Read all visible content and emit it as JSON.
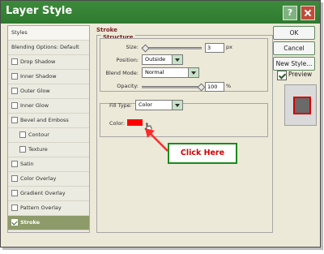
{
  "window": {
    "title": "Layer Style",
    "help_glyph": "?"
  },
  "styles_panel": {
    "items": [
      {
        "label": "Styles",
        "checkbox": false,
        "selected": false
      },
      {
        "label": "Blending Options: Default",
        "checkbox": false,
        "selected": false
      },
      {
        "label": "Drop Shadow",
        "checkbox": true,
        "selected": false
      },
      {
        "label": "Inner Shadow",
        "checkbox": true,
        "selected": false
      },
      {
        "label": "Outer Glow",
        "checkbox": true,
        "selected": false
      },
      {
        "label": "Inner Glow",
        "checkbox": true,
        "selected": false
      },
      {
        "label": "Bevel and Emboss",
        "checkbox": true,
        "selected": false
      },
      {
        "label": "Contour",
        "checkbox": true,
        "selected": false
      },
      {
        "label": "Texture",
        "checkbox": true,
        "selected": false
      },
      {
        "label": "Satin",
        "checkbox": true,
        "selected": false
      },
      {
        "label": "Color Overlay",
        "checkbox": true,
        "selected": false
      },
      {
        "label": "Gradient Overlay",
        "checkbox": true,
        "selected": false
      },
      {
        "label": "Pattern Overlay",
        "checkbox": true,
        "selected": false
      },
      {
        "label": "Stroke",
        "checkbox": true,
        "selected": true
      }
    ]
  },
  "stroke": {
    "section_title": "Stroke",
    "structure_title": "Structure",
    "size_label": "Size:",
    "size_value": "3",
    "size_unit": "px",
    "position_label": "Position:",
    "position_value": "Outside",
    "blend_mode_label": "Blend Mode:",
    "blend_mode_value": "Normal",
    "opacity_label": "Opacity:",
    "opacity_value": "100",
    "opacity_unit": "%",
    "fill_type_label": "Fill Type:",
    "fill_type_value": "Color",
    "color_label": "Color:",
    "color_value": "#ff0000"
  },
  "buttons": {
    "ok": "OK",
    "cancel": "Cancel",
    "new_style": "New Style...",
    "preview": "Preview"
  },
  "annotation": {
    "callout": "Click Here"
  },
  "colors": {
    "titlebar": "#2f7a2f",
    "selected_row": "#8d9b6a",
    "stroke_color": "#ff0000",
    "callout_border": "#1a8b1a",
    "callout_text": "#d60000"
  }
}
